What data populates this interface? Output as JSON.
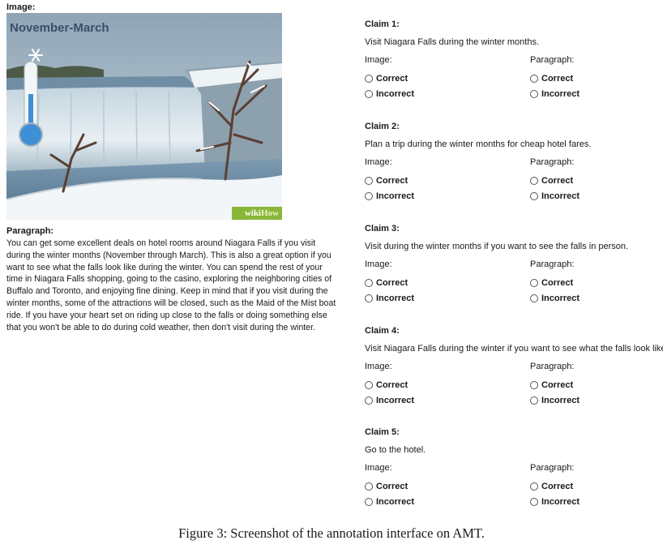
{
  "left": {
    "image_label": "Image:",
    "image": {
      "season_text": "November-March",
      "badge_wiki": "wiki",
      "badge_how": "How"
    },
    "paragraph_label": "Paragraph:",
    "paragraph_text": "You can get some excellent deals on hotel rooms around Niagara Falls if you visit during the winter months (November through March). This is also a great option if you want to see what the falls look like during the winter. You can spend the rest of your time in Niagara Falls shopping, going to the casino, exploring the neighboring cities of Buffalo and Toronto, and enjoying fine dining. Keep in mind that if you visit during the winter months, some of the attractions will be closed, such as the Maid of the Mist boat ride. If you have your heart set on riding up close to the falls or doing something else that you won't be able to do during cold weather, then don't visit during the winter."
  },
  "claims": [
    {
      "title": "Claim 1:",
      "text": "Visit Niagara Falls during the winter months.",
      "image_label": "Image:",
      "paragraph_label": "Paragraph:",
      "correct": "Correct",
      "incorrect": "Incorrect"
    },
    {
      "title": "Claim 2:",
      "text": "Plan a trip during the winter months for cheap hotel fares.",
      "image_label": "Image:",
      "paragraph_label": "Paragraph:",
      "correct": "Correct",
      "incorrect": "Incorrect"
    },
    {
      "title": "Claim 3:",
      "text": "Visit during the winter months if you want to see the falls in person.",
      "image_label": "Image:",
      "paragraph_label": "Paragraph:",
      "correct": "Correct",
      "incorrect": "Incorrect"
    },
    {
      "title": "Claim 4:",
      "text": "Visit Niagara Falls during the winter if you want to see what the falls look like.",
      "image_label": "Image:",
      "paragraph_label": "Paragraph:",
      "correct": "Correct",
      "incorrect": "Incorrect"
    },
    {
      "title": "Claim 5:",
      "text": "Go to the hotel.",
      "image_label": "Image:",
      "paragraph_label": "Paragraph:",
      "correct": "Correct",
      "incorrect": "Incorrect"
    }
  ],
  "caption": "Figure 3: Screenshot of the annotation interface on AMT.",
  "colors": {
    "wikihow_green": "#8ab73a",
    "thermometer_blue": "#3f8fd6"
  }
}
